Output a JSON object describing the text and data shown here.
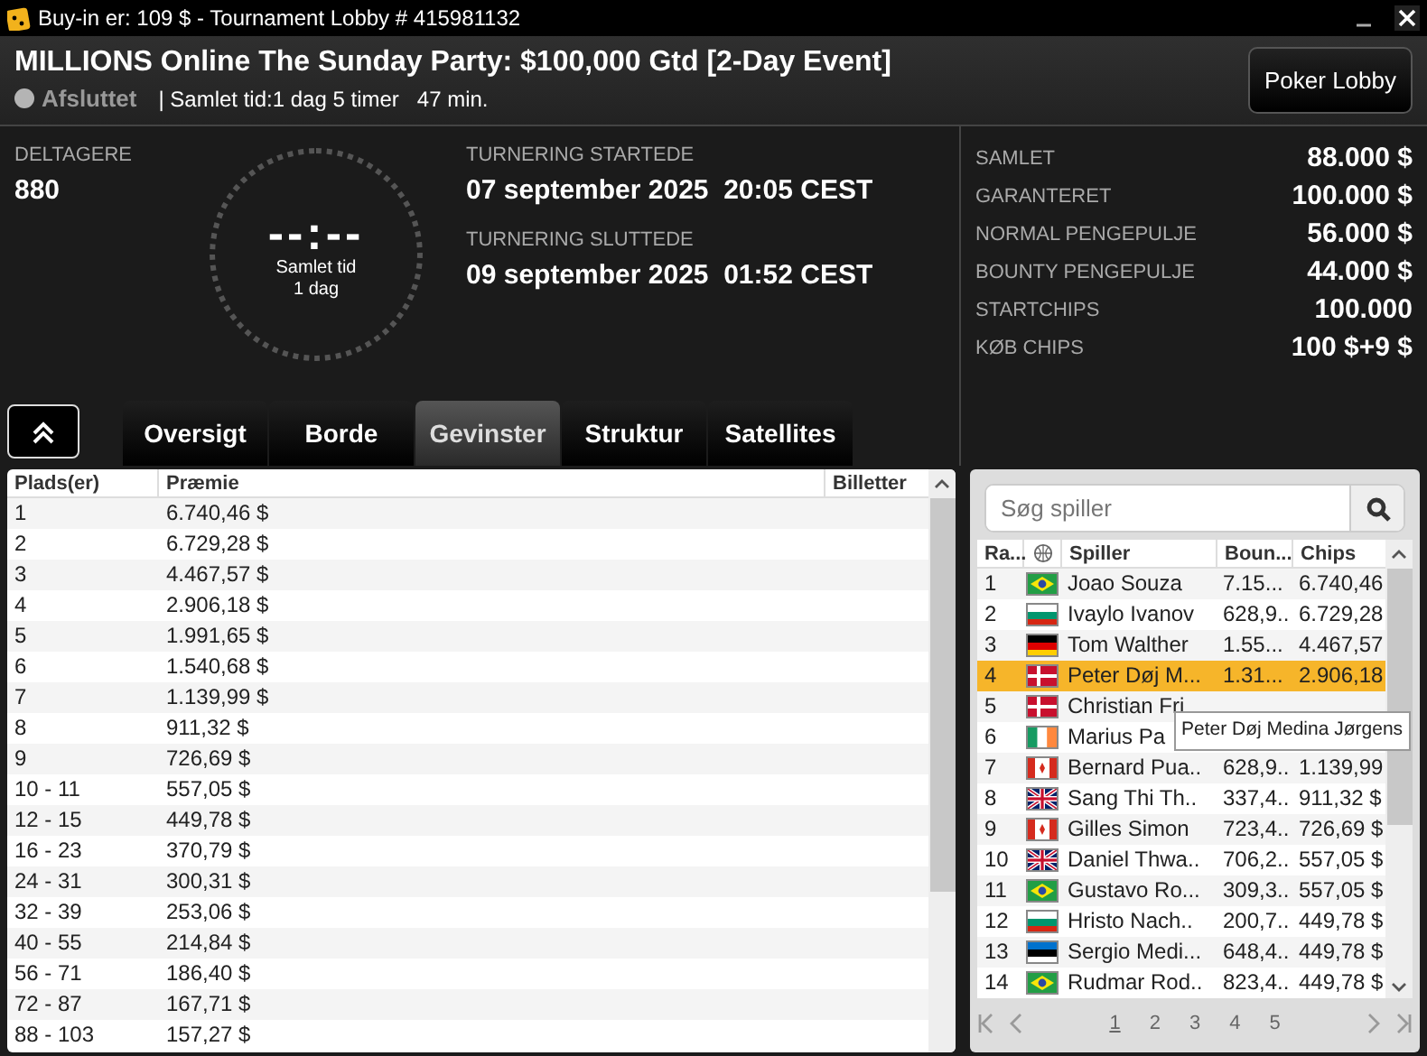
{
  "window": {
    "title": "Buy-in er: 109 $ - Tournament Lobby # 415981132"
  },
  "header": {
    "title": "MILLIONS Online The Sunday Party: $100,000 Gtd [2-Day Event]",
    "status": {
      "label": "Afsluttet",
      "color": "#b4b4b4"
    },
    "total_time": "| Samlet tid:1 dag 5 timer   47 min.",
    "lobby_button": "Poker Lobby"
  },
  "info": {
    "entrants_label": "DELTAGERE",
    "entrants": "880",
    "clock": {
      "display": "--:--",
      "label": "Samlet tid",
      "value": "1 dag"
    },
    "started_label": "TURNERING STARTEDE",
    "started": "07 september 2025  20:05 CEST",
    "ended_label": "TURNERING SLUTTEDE",
    "ended": "09 september 2025  01:52 CEST",
    "stats": [
      {
        "label": "SAMLET",
        "value": "88.000 $"
      },
      {
        "label": "GARANTERET",
        "value": "100.000 $"
      },
      {
        "label": "NORMAL PENGEPULJE",
        "value": "56.000 $"
      },
      {
        "label": "BOUNTY PENGEPULJE",
        "value": "44.000 $"
      },
      {
        "label": "STARTCHIPS",
        "value": "100.000"
      },
      {
        "label": "KØB CHIPS",
        "value": "100 $+9 $"
      }
    ]
  },
  "tabs": [
    {
      "label": "Oversigt",
      "selected": false
    },
    {
      "label": "Borde",
      "selected": false
    },
    {
      "label": "Gevinster",
      "selected": true
    },
    {
      "label": "Struktur",
      "selected": false
    },
    {
      "label": "Satellites",
      "selected": false
    }
  ],
  "prizes": {
    "columns": [
      "Plads(er)",
      "Præmie",
      "Billetter"
    ],
    "rows": [
      [
        "1",
        "6.740,46 $"
      ],
      [
        "2",
        "6.729,28 $"
      ],
      [
        "3",
        "4.467,57 $"
      ],
      [
        "4",
        "2.906,18 $"
      ],
      [
        "5",
        "1.991,65 $"
      ],
      [
        "6",
        "1.540,68 $"
      ],
      [
        "7",
        "1.139,99 $"
      ],
      [
        "8",
        "911,32 $"
      ],
      [
        "9",
        "726,69 $"
      ],
      [
        "10 - 11",
        "557,05 $"
      ],
      [
        "12 - 15",
        "449,78 $"
      ],
      [
        "16 - 23",
        "370,79 $"
      ],
      [
        "24 - 31",
        "300,31 $"
      ],
      [
        "32 - 39",
        "253,06 $"
      ],
      [
        "40 - 55",
        "214,84 $"
      ],
      [
        "56 - 71",
        "186,40 $"
      ],
      [
        "72 - 87",
        "167,71 $"
      ],
      [
        "88 - 103",
        "157,27 $"
      ]
    ]
  },
  "players": {
    "search": {
      "placeholder": "Søg spiller"
    },
    "columns": [
      "Ra...",
      "Spiller",
      "Boun...",
      "Chips"
    ],
    "rows": [
      {
        "rank": "1",
        "kind": "br",
        "name": "Joao Souza",
        "bounty": "7.15...",
        "chips": "6.740,46",
        "selected": false
      },
      {
        "rank": "2",
        "kind": "bg",
        "name": "Ivaylo Ivanov",
        "bounty": "628,9..",
        "chips": "6.729,28",
        "selected": false
      },
      {
        "rank": "3",
        "kind": "de",
        "name": "Tom Walther",
        "bounty": "1.55...",
        "chips": "4.467,57",
        "selected": false
      },
      {
        "rank": "4",
        "kind": "dk",
        "name": "Peter Døj M...",
        "bounty": "1.31...",
        "chips": "2.906,18",
        "selected": true
      },
      {
        "rank": "5",
        "kind": "dk",
        "name": "Christian Fri",
        "selected": false
      },
      {
        "rank": "6",
        "kind": "ie",
        "name": "Marius Pa",
        "selected": false
      },
      {
        "rank": "7",
        "kind": "ca",
        "name": "Bernard Pua..",
        "bounty": "628,9..",
        "chips": "1.139,99",
        "selected": false
      },
      {
        "rank": "8",
        "kind": "gb",
        "name": "Sang Thi Th..",
        "bounty": "337,4..",
        "chips": "911,32 $",
        "selected": false
      },
      {
        "rank": "9",
        "kind": "ca",
        "name": "Gilles Simon",
        "bounty": "723,4..",
        "chips": "726,69 $",
        "selected": false
      },
      {
        "rank": "10",
        "kind": "gb",
        "name": "Daniel Thwa..",
        "bounty": "706,2..",
        "chips": "557,05 $",
        "selected": false
      },
      {
        "rank": "11",
        "kind": "br",
        "name": "Gustavo Ro...",
        "bounty": "309,3..",
        "chips": "557,05 $",
        "selected": false
      },
      {
        "rank": "12",
        "kind": "bg",
        "name": "Hristo Nach..",
        "bounty": "200,7..",
        "chips": "449,78 $",
        "selected": false
      },
      {
        "rank": "13",
        "kind": "ee",
        "name": "Sergio Medi...",
        "bounty": "648,4..",
        "chips": "449,78 $",
        "selected": false
      },
      {
        "rank": "14",
        "kind": "br",
        "name": "Rudmar Rod..",
        "bounty": "823,4..",
        "chips": "449,78 $",
        "selected": false
      }
    ],
    "tooltip": "Peter Døj Medina Jørgens",
    "pages": [
      {
        "label": "1",
        "selected": true
      },
      {
        "label": "2",
        "selected": false
      },
      {
        "label": "3",
        "selected": false
      },
      {
        "label": "4",
        "selected": false
      },
      {
        "label": "5",
        "selected": false
      }
    ]
  }
}
